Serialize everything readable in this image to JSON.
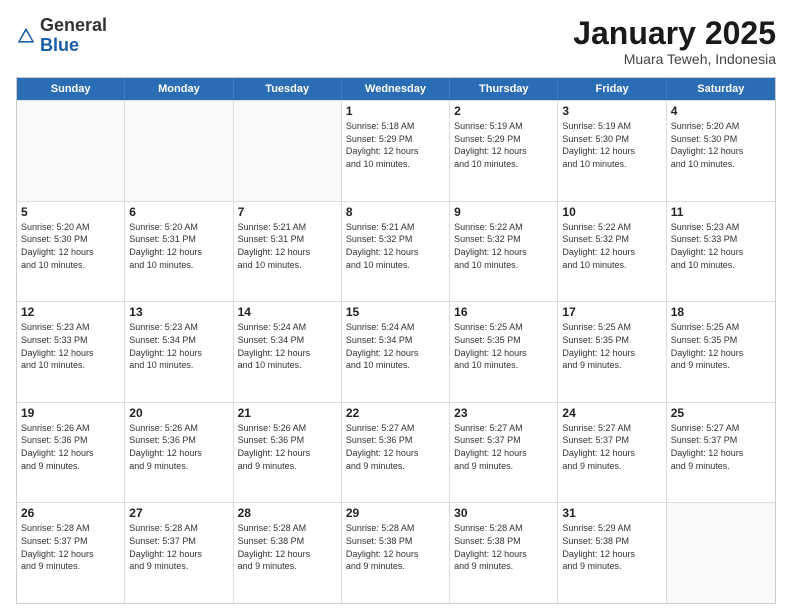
{
  "logo": {
    "general": "General",
    "blue": "Blue"
  },
  "title": "January 2025",
  "subtitle": "Muara Teweh, Indonesia",
  "days": [
    "Sunday",
    "Monday",
    "Tuesday",
    "Wednesday",
    "Thursday",
    "Friday",
    "Saturday"
  ],
  "weeks": [
    [
      {
        "day": "",
        "info": ""
      },
      {
        "day": "",
        "info": ""
      },
      {
        "day": "",
        "info": ""
      },
      {
        "day": "1",
        "info": "Sunrise: 5:18 AM\nSunset: 5:29 PM\nDaylight: 12 hours\nand 10 minutes."
      },
      {
        "day": "2",
        "info": "Sunrise: 5:19 AM\nSunset: 5:29 PM\nDaylight: 12 hours\nand 10 minutes."
      },
      {
        "day": "3",
        "info": "Sunrise: 5:19 AM\nSunset: 5:30 PM\nDaylight: 12 hours\nand 10 minutes."
      },
      {
        "day": "4",
        "info": "Sunrise: 5:20 AM\nSunset: 5:30 PM\nDaylight: 12 hours\nand 10 minutes."
      }
    ],
    [
      {
        "day": "5",
        "info": "Sunrise: 5:20 AM\nSunset: 5:30 PM\nDaylight: 12 hours\nand 10 minutes."
      },
      {
        "day": "6",
        "info": "Sunrise: 5:20 AM\nSunset: 5:31 PM\nDaylight: 12 hours\nand 10 minutes."
      },
      {
        "day": "7",
        "info": "Sunrise: 5:21 AM\nSunset: 5:31 PM\nDaylight: 12 hours\nand 10 minutes."
      },
      {
        "day": "8",
        "info": "Sunrise: 5:21 AM\nSunset: 5:32 PM\nDaylight: 12 hours\nand 10 minutes."
      },
      {
        "day": "9",
        "info": "Sunrise: 5:22 AM\nSunset: 5:32 PM\nDaylight: 12 hours\nand 10 minutes."
      },
      {
        "day": "10",
        "info": "Sunrise: 5:22 AM\nSunset: 5:32 PM\nDaylight: 12 hours\nand 10 minutes."
      },
      {
        "day": "11",
        "info": "Sunrise: 5:23 AM\nSunset: 5:33 PM\nDaylight: 12 hours\nand 10 minutes."
      }
    ],
    [
      {
        "day": "12",
        "info": "Sunrise: 5:23 AM\nSunset: 5:33 PM\nDaylight: 12 hours\nand 10 minutes."
      },
      {
        "day": "13",
        "info": "Sunrise: 5:23 AM\nSunset: 5:34 PM\nDaylight: 12 hours\nand 10 minutes."
      },
      {
        "day": "14",
        "info": "Sunrise: 5:24 AM\nSunset: 5:34 PM\nDaylight: 12 hours\nand 10 minutes."
      },
      {
        "day": "15",
        "info": "Sunrise: 5:24 AM\nSunset: 5:34 PM\nDaylight: 12 hours\nand 10 minutes."
      },
      {
        "day": "16",
        "info": "Sunrise: 5:25 AM\nSunset: 5:35 PM\nDaylight: 12 hours\nand 10 minutes."
      },
      {
        "day": "17",
        "info": "Sunrise: 5:25 AM\nSunset: 5:35 PM\nDaylight: 12 hours\nand 9 minutes."
      },
      {
        "day": "18",
        "info": "Sunrise: 5:25 AM\nSunset: 5:35 PM\nDaylight: 12 hours\nand 9 minutes."
      }
    ],
    [
      {
        "day": "19",
        "info": "Sunrise: 5:26 AM\nSunset: 5:36 PM\nDaylight: 12 hours\nand 9 minutes."
      },
      {
        "day": "20",
        "info": "Sunrise: 5:26 AM\nSunset: 5:36 PM\nDaylight: 12 hours\nand 9 minutes."
      },
      {
        "day": "21",
        "info": "Sunrise: 5:26 AM\nSunset: 5:36 PM\nDaylight: 12 hours\nand 9 minutes."
      },
      {
        "day": "22",
        "info": "Sunrise: 5:27 AM\nSunset: 5:36 PM\nDaylight: 12 hours\nand 9 minutes."
      },
      {
        "day": "23",
        "info": "Sunrise: 5:27 AM\nSunset: 5:37 PM\nDaylight: 12 hours\nand 9 minutes."
      },
      {
        "day": "24",
        "info": "Sunrise: 5:27 AM\nSunset: 5:37 PM\nDaylight: 12 hours\nand 9 minutes."
      },
      {
        "day": "25",
        "info": "Sunrise: 5:27 AM\nSunset: 5:37 PM\nDaylight: 12 hours\nand 9 minutes."
      }
    ],
    [
      {
        "day": "26",
        "info": "Sunrise: 5:28 AM\nSunset: 5:37 PM\nDaylight: 12 hours\nand 9 minutes."
      },
      {
        "day": "27",
        "info": "Sunrise: 5:28 AM\nSunset: 5:37 PM\nDaylight: 12 hours\nand 9 minutes."
      },
      {
        "day": "28",
        "info": "Sunrise: 5:28 AM\nSunset: 5:38 PM\nDaylight: 12 hours\nand 9 minutes."
      },
      {
        "day": "29",
        "info": "Sunrise: 5:28 AM\nSunset: 5:38 PM\nDaylight: 12 hours\nand 9 minutes."
      },
      {
        "day": "30",
        "info": "Sunrise: 5:28 AM\nSunset: 5:38 PM\nDaylight: 12 hours\nand 9 minutes."
      },
      {
        "day": "31",
        "info": "Sunrise: 5:29 AM\nSunset: 5:38 PM\nDaylight: 12 hours\nand 9 minutes."
      },
      {
        "day": "",
        "info": ""
      }
    ]
  ]
}
